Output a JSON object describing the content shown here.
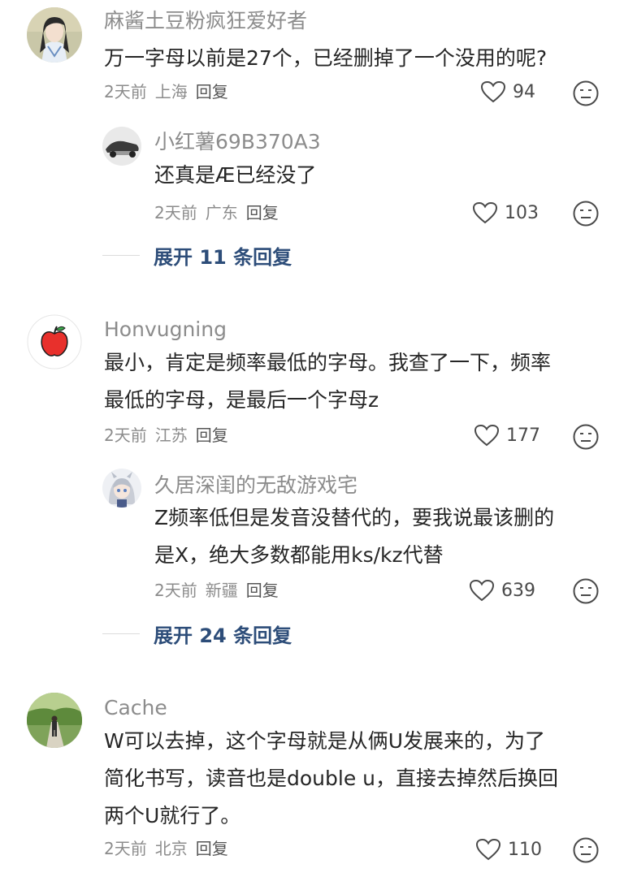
{
  "comments": [
    {
      "username": "麻酱土豆粉疯狂爱好者",
      "text": "万一字母以前是27个，已经删掉了一个没用的呢?",
      "time": "2天前",
      "location": "上海",
      "reply": "回复",
      "likes": "94",
      "replies": [
        {
          "username": "小红薯69B370A3",
          "text": "还真是Æ已经没了",
          "time": "2天前",
          "location": "广东",
          "reply": "回复",
          "likes": "103"
        }
      ],
      "expand": "展开 11 条回复"
    },
    {
      "username": "Honvugning",
      "text_lines": [
        "最小，肯定是频率最低的字母。我查了一下，频率",
        "最低的字母，是最后一个字母z"
      ],
      "time": "2天前",
      "location": "江苏",
      "reply": "回复",
      "likes": "177",
      "replies": [
        {
          "username": "久居深闺的无敌游戏宅",
          "text_lines": [
            "Z频率低但是发音没替代的，要我说最该删的",
            "是X，绝大多数都能用ks/kz代替"
          ],
          "time": "2天前",
          "location": "新疆",
          "reply": "回复",
          "likes": "639"
        }
      ],
      "expand": "展开 24 条回复"
    },
    {
      "username": "Cache",
      "text_lines": [
        "W可以去掉，这个字母就是从俩U发展来的，为了",
        "简化书写，读音也是double u，直接去掉然后换回",
        "两个U就行了。"
      ],
      "time": "2天前",
      "location": "北京",
      "reply": "回复",
      "likes": "110"
    }
  ],
  "colors": {
    "username": "#8c8c8c",
    "text": "#262626",
    "expand_link": "#2d4d79"
  },
  "icons": {
    "like": "heart-outline-icon",
    "reaction": "neutral-face-icon"
  }
}
